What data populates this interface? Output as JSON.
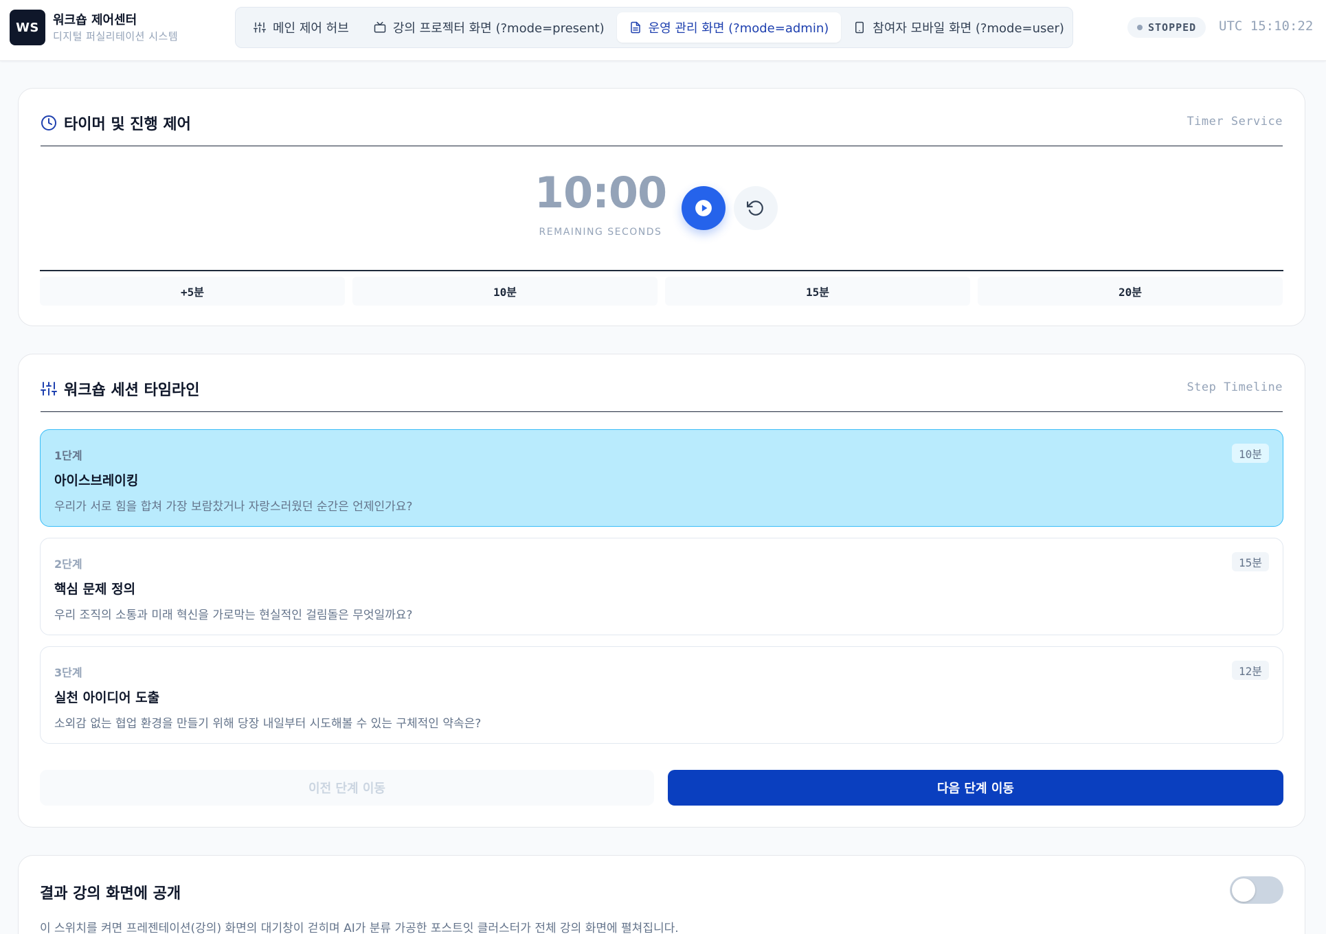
{
  "brand": {
    "logo": "WS",
    "title": "워크숍 제어센터",
    "subtitle": "디지털 퍼실리테이션 시스템"
  },
  "tabs": [
    {
      "label": "메인 제어 허브",
      "icon": "sliders-icon",
      "active": false
    },
    {
      "label": "강의 프로젝터 화면 (?mode=present)",
      "icon": "tv-icon",
      "active": false
    },
    {
      "label": "운영 관리 화면 (?mode=admin)",
      "icon": "document-icon",
      "active": true
    },
    {
      "label": "참여자 모바일 화면 (?mode=user)",
      "icon": "mobile-icon",
      "active": false
    }
  ],
  "status": {
    "label": "STOPPED",
    "clock": "UTC 15:10:22"
  },
  "timer_card": {
    "title": "타이머 및 진행 제어",
    "tag": "Timer Service",
    "value": "10:00",
    "caption": "REMAINING SECONDS",
    "presets": [
      "+5분",
      "10분",
      "15분",
      "20분"
    ]
  },
  "timeline_card": {
    "title": "워크숍 세션 타임라인",
    "tag": "Step Timeline",
    "steps": [
      {
        "num": "1단계",
        "title": "아이스브레이킹",
        "question": "우리가 서로 힘을 합쳐 가장 보람찼거나 자랑스러웠던 순간은 언제인가요?",
        "duration": "10분",
        "active": true
      },
      {
        "num": "2단계",
        "title": "핵심 문제 정의",
        "question": "우리 조직의 소통과 미래 혁신을 가로막는 현실적인 걸림돌은 무엇일까요?",
        "duration": "15분",
        "active": false
      },
      {
        "num": "3단계",
        "title": "실천 아이디어 도출",
        "question": "소외감 없는 협업 환경을 만들기 위해 당장 내일부터 시도해볼 수 있는 구체적인 약속은?",
        "duration": "12분",
        "active": false
      }
    ],
    "prev_label": "이전 단계 이동",
    "next_label": "다음 단계 이동"
  },
  "publish_card": {
    "title": "결과 강의 화면에 공개",
    "description": "이 스위치를 켜면 프레젠테이션(강의) 화면의 대기창이 걷히며 AI가 분류 가공한 포스트잇 클러스터가 전체 강의 화면에 펼쳐집니다.",
    "toggle_on": false
  },
  "colors": {
    "accent": "#2563eb",
    "primary_dark": "#0a3fbf",
    "active_step_bg": "#b9ebfd",
    "active_step_border": "#38bdf8"
  }
}
